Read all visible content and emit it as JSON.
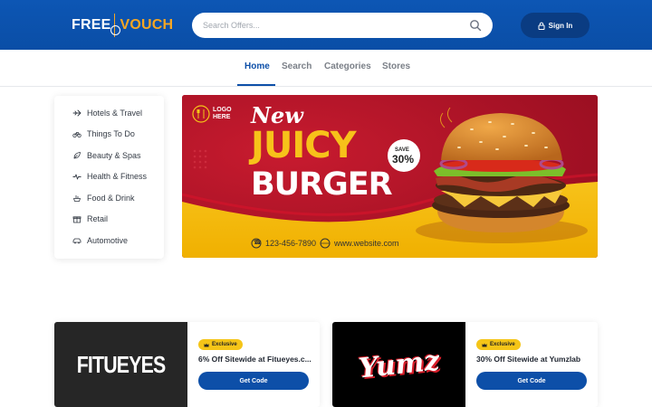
{
  "header": {
    "logo": {
      "part1": "FREE",
      "part2": "VOUCH"
    },
    "search": {
      "placeholder": "Search Offers..."
    },
    "signin_label": "Sign In"
  },
  "nav": {
    "items": [
      {
        "label": "Home",
        "active": true
      },
      {
        "label": "Search"
      },
      {
        "label": "Categories"
      },
      {
        "label": "Stores"
      }
    ]
  },
  "sidebar": {
    "items": [
      {
        "label": "Hotels & Travel",
        "icon": "plane-icon"
      },
      {
        "label": "Things To Do",
        "icon": "bicycle-icon"
      },
      {
        "label": "Beauty & Spas",
        "icon": "leaf-icon"
      },
      {
        "label": "Health & Fitness",
        "icon": "pulse-icon"
      },
      {
        "label": "Food & Drink",
        "icon": "food-icon"
      },
      {
        "label": "Retail",
        "icon": "gift-icon"
      },
      {
        "label": "Automotive",
        "icon": "car-icon"
      }
    ]
  },
  "banner": {
    "logo_text_line1": "LOGO",
    "logo_text_line2": "HERE",
    "headline_small": "New",
    "headline_1": "JUICY",
    "headline_2": "BURGER",
    "save_label": "SAVE",
    "save_value": "30%",
    "phone": "123-456-7890",
    "website": "www.website.com"
  },
  "cards": [
    {
      "brand": "FITUEYES",
      "badge": "Exclusive",
      "title": "6% Off Sitewide at Fitueyes.c...",
      "button": "Get Code"
    },
    {
      "brand": "Yumz",
      "badge": "Exclusive",
      "title": "30% Off Sitewide at Yumzlab",
      "button": "Get Code"
    }
  ],
  "colors": {
    "header_blue": "#0d56b4",
    "accent_orange": "#f5a623",
    "button_blue": "#0d4fa8",
    "badge_yellow": "#f5c518"
  }
}
